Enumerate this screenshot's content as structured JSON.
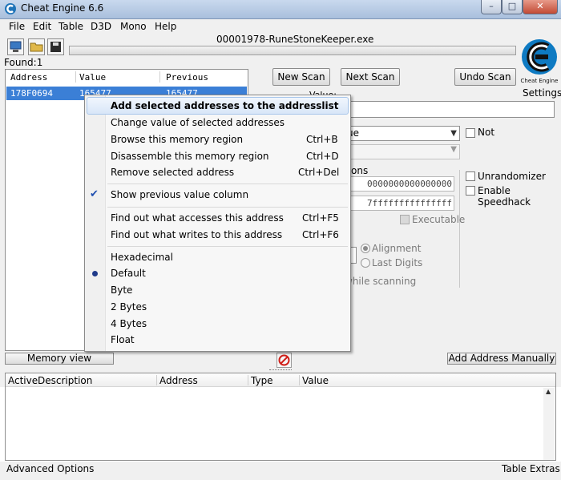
{
  "window": {
    "title": "Cheat Engine 6.6",
    "min": "–",
    "max": "□",
    "close": "✕"
  },
  "menu": [
    "File",
    "Edit",
    "Table",
    "D3D",
    "Mono",
    "Help"
  ],
  "process": "00001978-RuneStoneKeeper.exe",
  "found": "Found:1",
  "results": {
    "headers": [
      "Address",
      "Value",
      "Previous"
    ],
    "rows": [
      {
        "address": "178F0694",
        "value": "165477",
        "previous": "165477"
      }
    ]
  },
  "scan": {
    "new_scan": "New Scan",
    "next_scan": "Next Scan",
    "undo_scan": "Undo Scan",
    "value_label": "Value:",
    "scan_type_fragment": "ue",
    "not_label": "Not",
    "memory_options_fragment": "tions",
    "start": "0000000000000000",
    "stop": "7fffffffffffffff",
    "executable": "Executable",
    "alignment": "Alignment",
    "last_digits": "Last Digits",
    "while_scanning": "while scanning",
    "unrandomizer": "Unrandomizer",
    "speedhack": "Enable Speedhack"
  },
  "settings": "Settings",
  "logo_text": "Cheat Engine",
  "memory_view": "Memory view",
  "add_manually": "Add Address Manually",
  "address_list": {
    "headers": [
      "Active",
      "Description",
      "Address",
      "Type",
      "Value"
    ]
  },
  "status": {
    "left": "Advanced Options",
    "right": "Table Extras"
  },
  "context_menu": {
    "add_selected": "Add selected addresses to the addresslist",
    "change_value": "Change value of selected addresses",
    "browse": "Browse this memory region",
    "browse_shortcut": "Ctrl+B",
    "disassemble": "Disassemble this memory region",
    "disassemble_shortcut": "Ctrl+D",
    "remove": "Remove selected address",
    "remove_shortcut": "Ctrl+Del",
    "show_previous": "Show previous value column",
    "find_accesses": "Find out what accesses this address",
    "find_accesses_shortcut": "Ctrl+F5",
    "find_writes": "Find out what writes to this address",
    "find_writes_shortcut": "Ctrl+F6",
    "hexadecimal": "Hexadecimal",
    "default": "Default",
    "byte": "Byte",
    "2bytes": "2 Bytes",
    "4bytes": "4 Bytes",
    "float": "Float"
  }
}
